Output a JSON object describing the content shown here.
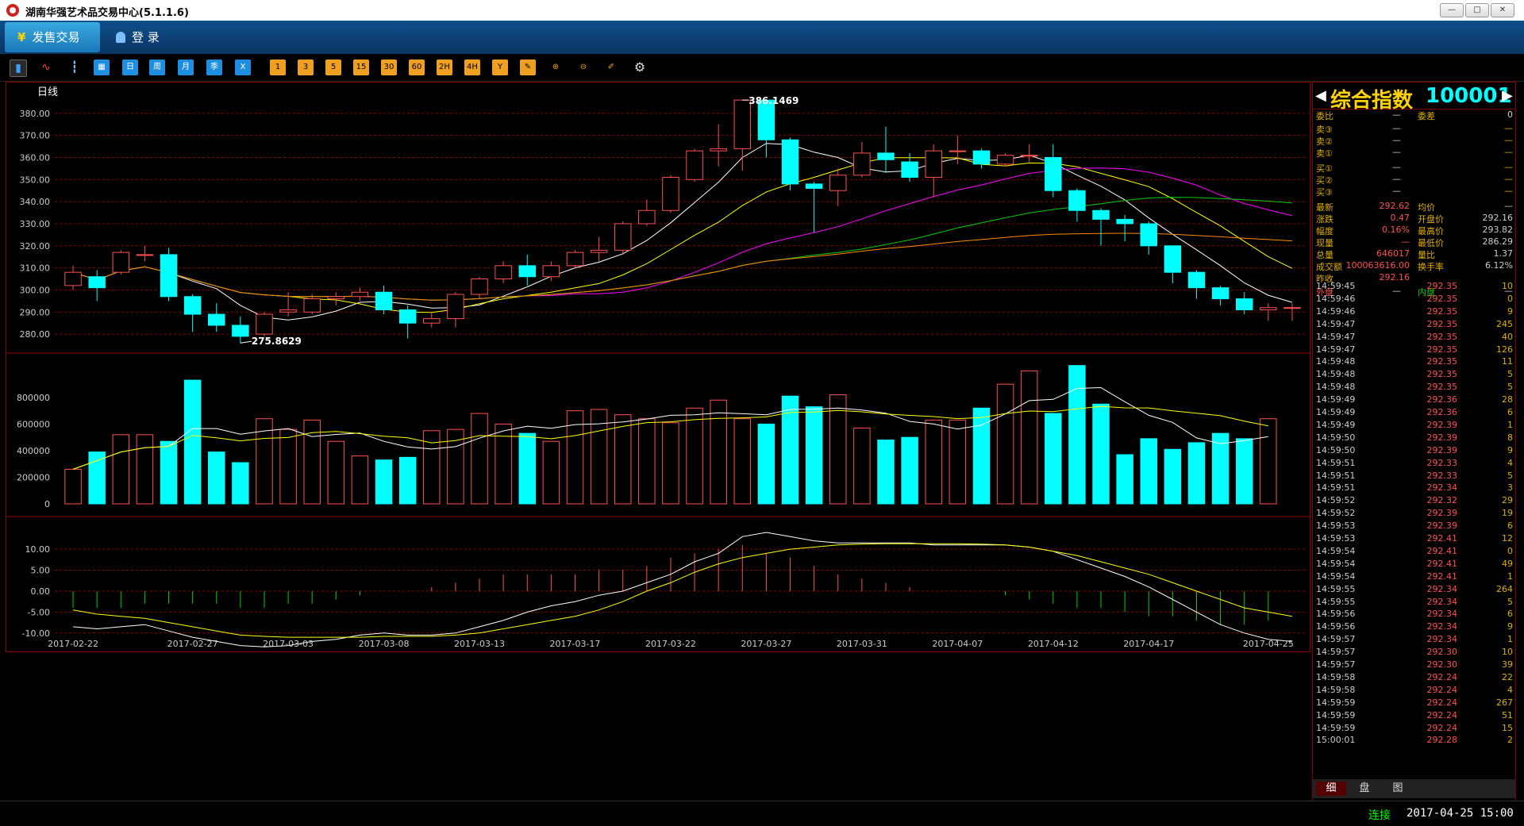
{
  "window": {
    "title": "湖南华强艺术品交易中心(5.1.1.6)"
  },
  "menu": {
    "active_tab": "发售交易",
    "login": "登 录",
    "login_icon": "user-icon",
    "trade_icon": "yen-icon"
  },
  "toolbar": {
    "buttons": [
      "日",
      "周",
      "月",
      "季",
      "X"
    ],
    "periods": [
      "1",
      "3",
      "5",
      "15",
      "30",
      "60",
      "2H",
      "4H",
      "Y"
    ]
  },
  "chart": {
    "period_label": "日线",
    "high_label": "386.1469",
    "low_label": "275.8629",
    "price_axis": [
      "380.00",
      "370.00",
      "360.00",
      "350.00",
      "340.00",
      "330.00",
      "320.00",
      "310.00",
      "300.00",
      "290.00",
      "280.00"
    ],
    "vol_axis": [
      "800000",
      "600000",
      "400000",
      "200000",
      "0"
    ],
    "macd_axis": [
      "10.00",
      "5.00",
      "0.00",
      "-5.00",
      "-10.00"
    ],
    "x_labels": [
      "2017-02-22",
      "2017-02-27",
      "2017-03-03",
      "2017-03-08",
      "2017-03-13",
      "2017-03-17",
      "2017-03-22",
      "2017-03-27",
      "2017-03-31",
      "2017-04-07",
      "2017-04-12",
      "2017-04-17",
      "2017-04-25"
    ],
    "colors": {
      "up": "#ff5050",
      "down": "#00ffff",
      "ma5": "#ffffff",
      "ma10": "#ffff00",
      "ma20": "#ff00ff",
      "ma30": "#00d000",
      "ma60": "#ff8c00",
      "grid": "#8b0000"
    }
  },
  "chart_data": {
    "type": "candlestick",
    "title": "日线",
    "candles": [
      {
        "o": 302,
        "c": 308,
        "h": 311,
        "l": 300
      },
      {
        "o": 306,
        "c": 301,
        "h": 309,
        "l": 295
      },
      {
        "o": 308,
        "c": 317,
        "h": 318,
        "l": 307
      },
      {
        "o": 316,
        "c": 316,
        "h": 320,
        "l": 313
      },
      {
        "o": 316,
        "c": 297,
        "h": 319,
        "l": 295
      },
      {
        "o": 297,
        "c": 289,
        "h": 298,
        "l": 281
      },
      {
        "o": 289,
        "c": 284,
        "h": 294,
        "l": 281
      },
      {
        "o": 284,
        "c": 279,
        "h": 288,
        "l": 276
      },
      {
        "o": 280,
        "c": 289,
        "h": 290,
        "l": 279
      },
      {
        "o": 290,
        "c": 291,
        "h": 299,
        "l": 288
      },
      {
        "o": 290,
        "c": 296,
        "h": 298,
        "l": 289
      },
      {
        "o": 296,
        "c": 297,
        "h": 299,
        "l": 293
      },
      {
        "o": 297,
        "c": 299,
        "h": 301,
        "l": 295
      },
      {
        "o": 299,
        "c": 291,
        "h": 302,
        "l": 289
      },
      {
        "o": 291,
        "c": 285,
        "h": 293,
        "l": 278
      },
      {
        "o": 285,
        "c": 287,
        "h": 290,
        "l": 283
      },
      {
        "o": 287,
        "c": 298,
        "h": 299,
        "l": 283
      },
      {
        "o": 298,
        "c": 305,
        "h": 306,
        "l": 296
      },
      {
        "o": 305,
        "c": 311,
        "h": 313,
        "l": 303
      },
      {
        "o": 311,
        "c": 306,
        "h": 316,
        "l": 302
      },
      {
        "o": 306,
        "c": 311,
        "h": 313,
        "l": 304
      },
      {
        "o": 311,
        "c": 317,
        "h": 318,
        "l": 310
      },
      {
        "o": 317,
        "c": 318,
        "h": 324,
        "l": 313
      },
      {
        "o": 318,
        "c": 330,
        "h": 331,
        "l": 316
      },
      {
        "o": 330,
        "c": 336,
        "h": 341,
        "l": 329
      },
      {
        "o": 336,
        "c": 351,
        "h": 352,
        "l": 335
      },
      {
        "o": 350,
        "c": 363,
        "h": 364,
        "l": 349
      },
      {
        "o": 363,
        "c": 364,
        "h": 375,
        "l": 356
      },
      {
        "o": 364,
        "c": 386,
        "h": 386,
        "l": 354
      },
      {
        "o": 386,
        "c": 368,
        "h": 386,
        "l": 360
      },
      {
        "o": 368,
        "c": 348,
        "h": 369,
        "l": 345
      },
      {
        "o": 348,
        "c": 346,
        "h": 349,
        "l": 326
      },
      {
        "o": 345,
        "c": 352,
        "h": 355,
        "l": 338
      },
      {
        "o": 352,
        "c": 362,
        "h": 367,
        "l": 351
      },
      {
        "o": 362,
        "c": 359,
        "h": 374,
        "l": 353
      },
      {
        "o": 358,
        "c": 351,
        "h": 362,
        "l": 349
      },
      {
        "o": 351,
        "c": 363,
        "h": 366,
        "l": 342
      },
      {
        "o": 363,
        "c": 363,
        "h": 370,
        "l": 357
      },
      {
        "o": 363,
        "c": 357,
        "h": 364,
        "l": 355
      },
      {
        "o": 357,
        "c": 361,
        "h": 362,
        "l": 356
      },
      {
        "o": 361,
        "c": 361,
        "h": 366,
        "l": 358
      },
      {
        "o": 360,
        "c": 345,
        "h": 366,
        "l": 342
      },
      {
        "o": 345,
        "c": 336,
        "h": 346,
        "l": 331
      },
      {
        "o": 336,
        "c": 332,
        "h": 337,
        "l": 320
      },
      {
        "o": 332,
        "c": 330,
        "h": 334,
        "l": 322
      },
      {
        "o": 330,
        "c": 320,
        "h": 331,
        "l": 316
      },
      {
        "o": 320,
        "c": 308,
        "h": 320,
        "l": 303
      },
      {
        "o": 308,
        "c": 301,
        "h": 309,
        "l": 296
      },
      {
        "o": 301,
        "c": 296,
        "h": 302,
        "l": 293
      },
      {
        "o": 296,
        "c": 291,
        "h": 299,
        "l": 289
      },
      {
        "o": 291,
        "c": 292,
        "h": 294,
        "l": 286
      },
      {
        "o": 292,
        "c": 292,
        "h": 294,
        "l": 286
      }
    ],
    "volume": [
      260000,
      390000,
      520000,
      520000,
      470000,
      930000,
      390000,
      310000,
      640000,
      560000,
      630000,
      470000,
      360000,
      330000,
      350000,
      550000,
      560000,
      680000,
      600000,
      530000,
      470000,
      700000,
      710000,
      670000,
      640000,
      610000,
      720000,
      780000,
      640000,
      600000,
      810000,
      730000,
      820000,
      570000,
      480000,
      500000,
      630000,
      630000,
      720000,
      900000,
      1000000,
      680000,
      1040000,
      750000,
      370000,
      490000,
      410000,
      460000,
      530000,
      490000,
      640000
    ],
    "macd_hist": [
      -4,
      -4,
      -4,
      -3,
      -3,
      -3,
      -3,
      -4,
      -4,
      -3,
      -3,
      -2,
      -1,
      0,
      0,
      1,
      2,
      3,
      4,
      4,
      4,
      4,
      5,
      5,
      6,
      8,
      9,
      10,
      11,
      9,
      8,
      6,
      4,
      3,
      2,
      1,
      0,
      0,
      0,
      -1,
      -2,
      -3,
      -4,
      -4,
      -5,
      -6,
      -6,
      -7,
      -8,
      -8,
      -7
    ],
    "macd_dif": [
      -8.5,
      -9,
      -8.5,
      -8,
      -9.5,
      -11,
      -12,
      -13,
      -13.3,
      -13,
      -12,
      -11.5,
      -10.5,
      -10,
      -10.5,
      -10.5,
      -10,
      -8.5,
      -7,
      -5,
      -3.5,
      -2.5,
      -1,
      0,
      2,
      4,
      7,
      9,
      13,
      14,
      13,
      12,
      11.5,
      11.5,
      11.5,
      11.5,
      11,
      11,
      11,
      11,
      10.5,
      9.5,
      7.5,
      5.5,
      3.5,
      1,
      -2,
      -5,
      -8,
      -10,
      -11.5,
      -12
    ],
    "macd_dea": [
      -4.5,
      -5.5,
      -6,
      -6.5,
      -7.5,
      -8.5,
      -9.5,
      -10.5,
      -10.8,
      -11,
      -11,
      -11,
      -11,
      -10.8,
      -10.8,
      -10.8,
      -10.5,
      -10,
      -9,
      -8,
      -7,
      -6,
      -4.5,
      -2.5,
      0,
      2,
      4.5,
      6.5,
      8,
      9,
      10,
      10.5,
      11,
      11.2,
      11.3,
      11.3,
      11.3,
      11.3,
      11.2,
      11,
      10.5,
      9.5,
      8.5,
      7,
      5.5,
      4,
      2,
      0,
      -2,
      -4,
      -5,
      -6
    ],
    "xlabel": "",
    "ylabel": ""
  },
  "quote": {
    "name": "综合指数",
    "code": "100001",
    "weibi_label": "委比",
    "weibi": "—",
    "weicha_label": "委差",
    "weicha": "0",
    "asks": [
      {
        "label": "卖③",
        "price": "—",
        "vol": "—"
      },
      {
        "label": "卖②",
        "price": "—",
        "vol": "—"
      },
      {
        "label": "卖①",
        "price": "—",
        "vol": "—"
      }
    ],
    "bids": [
      {
        "label": "买①",
        "price": "—",
        "vol": "—"
      },
      {
        "label": "买②",
        "price": "—",
        "vol": "—"
      },
      {
        "label": "买③",
        "price": "—",
        "vol": "—"
      }
    ],
    "stats": [
      {
        "l1": "最新",
        "v1": "292.62",
        "l2": "均价",
        "v2": "—"
      },
      {
        "l1": "涨跌",
        "v1": "0.47",
        "l2": "开盘价",
        "v2": "292.16"
      },
      {
        "l1": "幅度",
        "v1": "0.16%",
        "l2": "最高价",
        "v2": "293.82"
      },
      {
        "l1": "现量",
        "v1": "—",
        "l2": "最低价",
        "v2": "286.29"
      },
      {
        "l1": "总量",
        "v1": "646017",
        "l2": "量比",
        "v2": "1.37"
      },
      {
        "l1": "成交额",
        "v1": "100063616.00",
        "l2": "换手率",
        "v2": "6.12%"
      },
      {
        "l1": "昨收",
        "v1": "292.16",
        "l2": "",
        "v2": ""
      }
    ],
    "outer_label": "外盘",
    "outer": "—",
    "inner_label": "内盘",
    "inner": "—"
  },
  "ticks": [
    [
      "14:59:45",
      "292.35",
      "10"
    ],
    [
      "14:59:46",
      "292.35",
      "0"
    ],
    [
      "14:59:46",
      "292.35",
      "9"
    ],
    [
      "14:59:47",
      "292.35",
      "245"
    ],
    [
      "14:59:47",
      "292.35",
      "40"
    ],
    [
      "14:59:47",
      "292.35",
      "126"
    ],
    [
      "14:59:48",
      "292.35",
      "11"
    ],
    [
      "14:59:48",
      "292.35",
      "5"
    ],
    [
      "14:59:48",
      "292.35",
      "5"
    ],
    [
      "14:59:49",
      "292.36",
      "28"
    ],
    [
      "14:59:49",
      "292.36",
      "6"
    ],
    [
      "14:59:49",
      "292.39",
      "1"
    ],
    [
      "14:59:50",
      "292.39",
      "8"
    ],
    [
      "14:59:50",
      "292.39",
      "9"
    ],
    [
      "14:59:51",
      "292.33",
      "4"
    ],
    [
      "14:59:51",
      "292.33",
      "5"
    ],
    [
      "14:59:51",
      "292.34",
      "3"
    ],
    [
      "14:59:52",
      "292.32",
      "29"
    ],
    [
      "14:59:52",
      "292.39",
      "19"
    ],
    [
      "14:59:53",
      "292.39",
      "6"
    ],
    [
      "14:59:53",
      "292.41",
      "12"
    ],
    [
      "14:59:54",
      "292.41",
      "0"
    ],
    [
      "14:59:54",
      "292.41",
      "49"
    ],
    [
      "14:59:54",
      "292.41",
      "1"
    ],
    [
      "14:59:55",
      "292.34",
      "264"
    ],
    [
      "14:59:55",
      "292.34",
      "5"
    ],
    [
      "14:59:56",
      "292.34",
      "6"
    ],
    [
      "14:59:56",
      "292.34",
      "9"
    ],
    [
      "14:59:57",
      "292.34",
      "1"
    ],
    [
      "14:59:57",
      "292.30",
      "10"
    ],
    [
      "14:59:57",
      "292.30",
      "39"
    ],
    [
      "14:59:58",
      "292.24",
      "22"
    ],
    [
      "14:59:58",
      "292.24",
      "4"
    ],
    [
      "14:59:59",
      "292.24",
      "267"
    ],
    [
      "14:59:59",
      "292.24",
      "51"
    ],
    [
      "14:59:59",
      "292.24",
      "15"
    ],
    [
      "15:00:01",
      "292.28",
      "2"
    ]
  ],
  "tabs": [
    "细",
    "盘",
    "图"
  ],
  "status": {
    "connection": "连接",
    "time": "2017-04-25 15:00"
  }
}
